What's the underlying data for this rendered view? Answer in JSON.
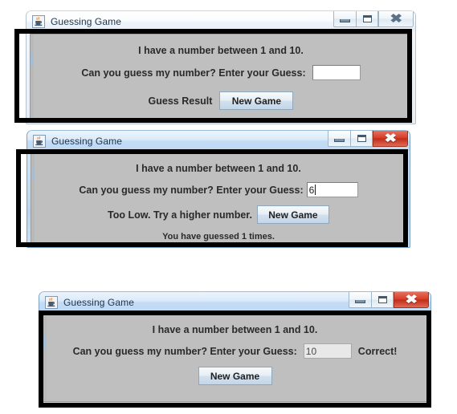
{
  "app": {
    "title": "Guessing Game",
    "icon": "java-coffee-cup-icon"
  },
  "labels": {
    "prompt_range": "I have a number between 1 and 10.",
    "prompt_guess": "Can you guess my number? Enter your Guess:",
    "new_game": "New Game",
    "minimize": "Minimize",
    "maximize": "Maximize",
    "close": "Close"
  },
  "colors": {
    "client_background": "#bfbfbf",
    "close_button_active": "#d8412a",
    "button_face": "#e6eef5",
    "title_text": "#21374c",
    "label_text": "#2a2a2a"
  },
  "windows": [
    {
      "id": "window-initial",
      "title": "Guessing Game",
      "state": "inactive",
      "close_button_style": "plain",
      "prompt_range": "I have a number between 1 and 10.",
      "prompt_guess": "Can you guess my number? Enter your Guess:",
      "guess_value": "",
      "guess_placeholder": "",
      "guess_field_enabled": true,
      "caret_visible": false,
      "result_text": "Guess Result",
      "new_game_label": "New Game",
      "counter_text": "",
      "trailing_text": "",
      "annotated": true
    },
    {
      "id": "window-too-low",
      "title": "Guessing Game",
      "state": "active",
      "close_button_style": "red",
      "prompt_range": "I have a number between 1 and 10.",
      "prompt_guess": "Can you guess my number? Enter your Guess:",
      "guess_value": "6",
      "guess_placeholder": "",
      "guess_field_enabled": true,
      "caret_visible": true,
      "result_text": "Too Low. Try a higher number.",
      "new_game_label": "New Game",
      "counter_text": "You have guessed 1 times.",
      "trailing_text": "",
      "annotated": true
    },
    {
      "id": "window-correct",
      "title": "Guessing Game",
      "state": "active",
      "close_button_style": "red",
      "prompt_range": "I have a number between 1 and 10.",
      "prompt_guess": "Can you guess my number? Enter your Guess:",
      "guess_value": "10",
      "guess_placeholder": "",
      "guess_field_enabled": false,
      "caret_visible": false,
      "result_text": "",
      "new_game_label": "New Game",
      "counter_text": "",
      "trailing_text": "Correct!",
      "annotated": true
    }
  ]
}
